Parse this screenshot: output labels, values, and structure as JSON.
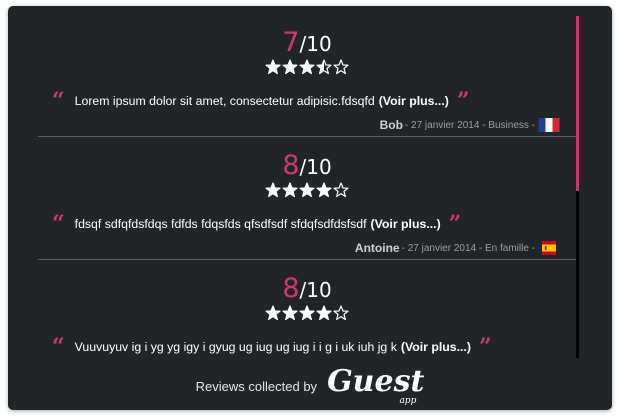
{
  "reviews": [
    {
      "score": "7",
      "scale": "/10",
      "stars_rating": 3.5,
      "text": "Lorem ipsum dolor sit amet, consectetur adipisic.fdsqfd",
      "more_label": "(Voir plus...)",
      "author": "Bob",
      "details": " - 27 janvier 2014 - Business - ",
      "flag": "france-flag-icon"
    },
    {
      "score": "8",
      "scale": "/10",
      "stars_rating": 4,
      "text": "fdsqf sdfqfdsfdqs fdfds fdqsfds qfsdfsdf sfdqfsdfdsfsdf",
      "more_label": "(Voir plus...)",
      "author": "Antoine",
      "details": " - 27 janvier 2014 - En famille - ",
      "flag": "spain-flag-icon"
    },
    {
      "score": "8",
      "scale": "/10",
      "stars_rating": 4,
      "text": "Vuuvuyuv ig i yg yg igy i gyug ug iug ug iug i i g i uk iuh jg k",
      "more_label": "(Voir plus...)",
      "author": "",
      "details": "",
      "flag": ""
    }
  ],
  "footer": {
    "collected_label": "Reviews collected by",
    "logo_word": "Guest",
    "logo_sub": "app"
  },
  "scroll": {
    "position": 0
  },
  "colors": {
    "background": "#222528",
    "accent": "#c93a6a",
    "text": "#ffffff",
    "divider": "#5b5f63"
  }
}
